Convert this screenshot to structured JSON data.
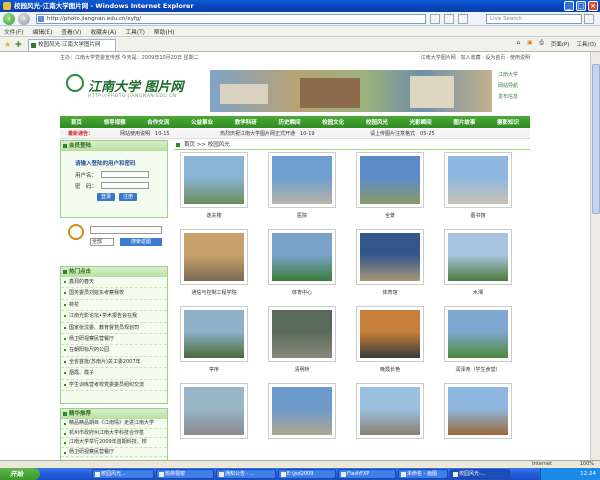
{
  "window": {
    "title": "校园风光-江南大学图片网 - Windows Internet Explorer"
  },
  "address": {
    "url": "http://photo.jiangnan.edu.cn/xyfg/",
    "live_search_placeholder": "Live Search"
  },
  "menu": [
    "文件(F)",
    "编辑(E)",
    "查看(V)",
    "收藏夹(A)",
    "工具(T)",
    "帮助(H)"
  ],
  "tab": {
    "label": "校园风光-江南大学图片网"
  },
  "toolbar_right": [
    "页面(P)",
    "工具(O)"
  ],
  "page": {
    "topline_left": "主办：江南大学党委宣传部   今天是：2009年10月20日 星期二",
    "topline_right": "江南大学图片网 · 加入收藏 · 设为首页 · 使用说明",
    "logo_text": "江南大学 图片网",
    "logo_sub": "HTTP://PHOTO.JIANGNAN.EDU.CN",
    "banner_links": [
      "江南大学",
      "网站导航",
      "发布信息"
    ],
    "nav": [
      "首页",
      "领导视察",
      "合作交流",
      "公益事业",
      "教学科研",
      "历史瞬间",
      "校园文化",
      "校园风光",
      "光影瞬间",
      "图片故事",
      "摄影知识"
    ],
    "news": {
      "label": "最新通告：",
      "items": [
        {
          "text": "网站使用说明",
          "date": "10-15"
        },
        {
          "text": "热烈庆祝江南大学图片网正式开通",
          "date": "10-19"
        },
        {
          "text": "请上传图片注意格式",
          "date": "05-25"
        }
      ]
    },
    "login": {
      "title": "会员登陆",
      "hint": "请输入登陆的用户和密码",
      "user_label": "用户名：",
      "pass_label": "密　码：",
      "login_btn": "登录",
      "register_btn": "注册"
    },
    "search": {
      "select": "全部",
      "button": "搜索返图"
    },
    "hot": {
      "title": "热门点击",
      "items": [
        "鑫洞的春天",
        "国务委员刘延东考察我校",
        "荷花",
        "江南光影论坛•学术报告会在我",
        "国家张沈委、教育督党员规划司",
        "杨卫研视察民营餐厅",
        "在朝阳标尺的公园",
        "全省首批(苏南片)关工委2007年",
        "烟霞、霞子",
        "学生训练营考校党委委员组织交流"
      ]
    },
    "recommend": {
      "title": "精华推荐",
      "items": [
        "精品精品期目《江南情》走进江南大学",
        "杭州市政府州江南大学科技合作签",
        "江南大学举行2009年首期科技、校",
        "杨卫研视察民营餐厅"
      ]
    },
    "crumb": "首页 >> 校园风光",
    "photos": [
      {
        "caption": "逸夫楼",
        "c1": "#8ab4d6",
        "c2": "#6d8c5a"
      },
      {
        "caption": "医院",
        "c1": "#6f9fd0",
        "c2": "#b9b4a8"
      },
      {
        "caption": "全景",
        "c1": "#5c8cc8",
        "c2": "#8a9a6a"
      },
      {
        "caption": "图书馆",
        "c1": "#8fb7e0",
        "c2": "#c9c2b4"
      },
      {
        "caption": "通信与控制工程学院",
        "c1": "#c9a06a",
        "c2": "#7a6a52"
      },
      {
        "caption": "体育中心",
        "c1": "#79a3c9",
        "c2": "#3a7a3a"
      },
      {
        "caption": "体育馆",
        "c1": "#33568a",
        "c2": "#a89878"
      },
      {
        "caption": "水湘",
        "c1": "#a8c4e0",
        "c2": "#4e7a3c"
      },
      {
        "caption": "亭序",
        "c1": "#8eb0c8",
        "c2": "#4a6a3a"
      },
      {
        "caption": "清明桥",
        "c1": "#5a6a5a",
        "c2": "#8a8a7a"
      },
      {
        "caption": "晚霞长艳",
        "c1": "#c7803a",
        "c2": "#3a3a3a"
      },
      {
        "caption": "润泽苑（学生食堂）",
        "c1": "#7fa8d0",
        "c2": "#4a8a3a"
      },
      {
        "caption": "",
        "c1": "#9ab4c8",
        "c2": "#8a8a8a"
      },
      {
        "caption": "",
        "c1": "#6c9acb",
        "c2": "#b0a890"
      },
      {
        "caption": "",
        "c1": "#9cc0e0",
        "c2": "#8a8070"
      },
      {
        "caption": "",
        "c1": "#8fb7e0",
        "c2": "#9a6a3a"
      }
    ]
  },
  "status": {
    "zone": "Internet",
    "zoom": "100%"
  },
  "taskbar": {
    "start": "开始",
    "tasks": [
      "校园风光...",
      "热荷视窗",
      "通知公告 - ...",
      "E:\\jsd2009",
      "FlashFXP",
      "未命名 - 画图",
      "校园风光-..."
    ],
    "clock": "12:24"
  }
}
